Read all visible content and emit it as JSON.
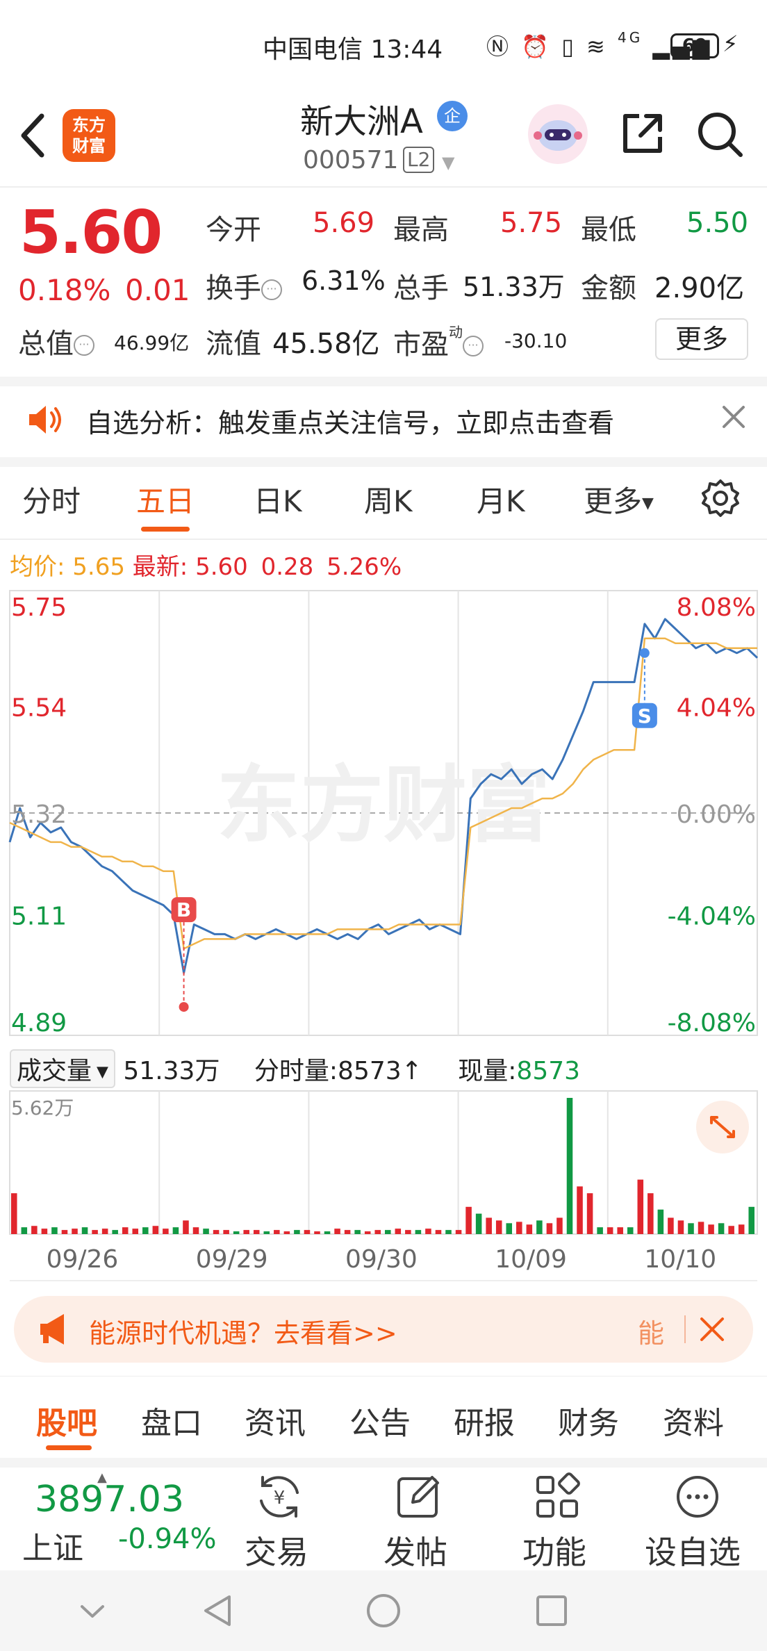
{
  "status_bar": {
    "carrier": "中国电信",
    "time": "13:44",
    "network": "4G",
    "battery": "69"
  },
  "header": {
    "stock_name": "新大洲A",
    "badge": "企",
    "stock_code": "000571",
    "level_badge": "L2",
    "logo_line1": "东方",
    "logo_line2": "财富"
  },
  "quote": {
    "price": "5.60",
    "change_pct": "0.18%",
    "change": "0.01",
    "rows": [
      [
        {
          "label": "今开",
          "value": "5.69",
          "color": "red"
        },
        {
          "label": "最高",
          "value": "5.75",
          "color": "red"
        },
        {
          "label": "最低",
          "value": "5.50",
          "color": "green"
        }
      ],
      [
        {
          "label": "换手",
          "value": "6.31%",
          "color": "black"
        },
        {
          "label": "总手",
          "value": "51.33万",
          "color": "black"
        },
        {
          "label": "金额",
          "value": "2.90亿",
          "color": "black"
        }
      ],
      [
        {
          "label": "总值",
          "value": "46.99亿",
          "color": "black"
        },
        {
          "label": "流值",
          "value": "45.58亿",
          "color": "black"
        },
        {
          "label": "市盈",
          "sup": "动",
          "value": "-30.10",
          "color": "black"
        }
      ]
    ],
    "more_label": "更多"
  },
  "notice": {
    "text": "自选分析：触发重点关注信号，立即点击查看"
  },
  "chart_tabs": {
    "items": [
      "分时",
      "五日",
      "日K",
      "周K",
      "月K",
      "更多"
    ],
    "active": "五日"
  },
  "avg_row": {
    "avg_label": "均价:",
    "avg_value": "5.65",
    "latest_label": "最新:",
    "latest_value": "5.60",
    "change": "0.28",
    "change_pct": "5.26%"
  },
  "watermark": "东方财富",
  "chart_data": {
    "type": "line",
    "title": "",
    "y_ticks_left": [
      "5.75",
      "5.54",
      "5.32",
      "5.11",
      "4.89"
    ],
    "y_ticks_right": [
      "8.08%",
      "4.04%",
      "0.00%",
      "-4.04%",
      "-8.08%"
    ],
    "ylim": [
      4.89,
      5.75
    ],
    "x_days": [
      "09/26",
      "09/29",
      "09/30",
      "10/09",
      "10/10"
    ],
    "series": [
      {
        "color": "#3a73b8",
        "values": [
          5.26,
          5.33,
          5.27,
          5.3,
          5.28,
          5.29,
          5.26,
          5.25,
          5.23,
          5.21,
          5.2,
          5.18,
          5.16,
          5.15,
          5.14,
          5.13,
          5.11,
          4.99,
          5.09,
          5.08,
          5.07,
          5.07,
          5.06,
          5.07,
          5.06,
          5.07,
          5.08,
          5.07,
          5.06,
          5.07,
          5.08,
          5.07,
          5.06,
          5.07,
          5.06,
          5.08,
          5.09,
          5.07,
          5.08,
          5.09,
          5.1,
          5.08,
          5.09,
          5.08,
          5.07,
          5.35,
          5.38,
          5.4,
          5.39,
          5.41,
          5.38,
          5.4,
          5.41,
          5.39,
          5.43,
          5.48,
          5.53,
          5.59,
          5.59,
          5.59,
          5.59,
          5.59,
          5.71,
          5.68,
          5.72,
          5.7,
          5.68,
          5.66,
          5.67,
          5.65,
          5.66,
          5.65,
          5.66,
          5.64
        ]
      },
      {
        "color": "#f0b44a",
        "values": [
          5.3,
          5.29,
          5.28,
          5.27,
          5.26,
          5.26,
          5.25,
          5.25,
          5.24,
          5.23,
          5.23,
          5.22,
          5.22,
          5.21,
          5.21,
          5.2,
          5.2,
          5.04,
          5.05,
          5.06,
          5.06,
          5.06,
          5.06,
          5.07,
          5.07,
          5.07,
          5.07,
          5.07,
          5.07,
          5.07,
          5.07,
          5.07,
          5.08,
          5.08,
          5.08,
          5.08,
          5.08,
          5.08,
          5.09,
          5.09,
          5.09,
          5.09,
          5.09,
          5.09,
          5.09,
          5.29,
          5.3,
          5.31,
          5.32,
          5.33,
          5.33,
          5.34,
          5.35,
          5.35,
          5.36,
          5.38,
          5.41,
          5.43,
          5.44,
          5.45,
          5.45,
          5.45,
          5.68,
          5.68,
          5.68,
          5.67,
          5.67,
          5.67,
          5.67,
          5.67,
          5.66,
          5.66,
          5.66,
          5.66
        ]
      }
    ],
    "markers": [
      {
        "label": "B",
        "value": 4.92,
        "index": 17,
        "color": "#e84a4a"
      },
      {
        "label": "S",
        "value": 5.65,
        "index": 62,
        "color": "#4a8de8"
      }
    ],
    "grid": true
  },
  "volume": {
    "select_label": "成交量",
    "total": "51.33万",
    "minute_label": "分时量:",
    "minute_value": "8573↑",
    "current_label": "现量:",
    "current_value": "8573",
    "axis_max": "5.62万",
    "bars": [
      0.3,
      0.05,
      0.06,
      0.04,
      0.05,
      0.03,
      0.04,
      0.05,
      0.03,
      0.04,
      0.03,
      0.05,
      0.04,
      0.05,
      0.06,
      0.04,
      0.05,
      0.1,
      0.05,
      0.04,
      0.03,
      0.03,
      0.02,
      0.03,
      0.03,
      0.02,
      0.03,
      0.02,
      0.03,
      0.03,
      0.02,
      0.02,
      0.04,
      0.03,
      0.03,
      0.02,
      0.03,
      0.03,
      0.04,
      0.03,
      0.03,
      0.04,
      0.03,
      0.03,
      0.03,
      0.2,
      0.15,
      0.12,
      0.1,
      0.08,
      0.09,
      0.07,
      0.1,
      0.08,
      0.12,
      1.0,
      0.35,
      0.3,
      0.05,
      0.05,
      0.05,
      0.05,
      0.4,
      0.3,
      0.18,
      0.12,
      0.1,
      0.08,
      0.09,
      0.07,
      0.08,
      0.06,
      0.07,
      0.2
    ]
  },
  "ad": {
    "text": "能源时代机遇？去看看>>",
    "side": "能"
  },
  "section_tabs": {
    "items": [
      "股吧",
      "盘口",
      "资讯",
      "公告",
      "研报",
      "财务",
      "资料"
    ],
    "active": "股吧"
  },
  "toolbar": {
    "index_value": "3897.03",
    "index_name": "上证",
    "index_pct": "-0.94%",
    "items": [
      "交易",
      "发帖",
      "功能",
      "设自选"
    ]
  }
}
